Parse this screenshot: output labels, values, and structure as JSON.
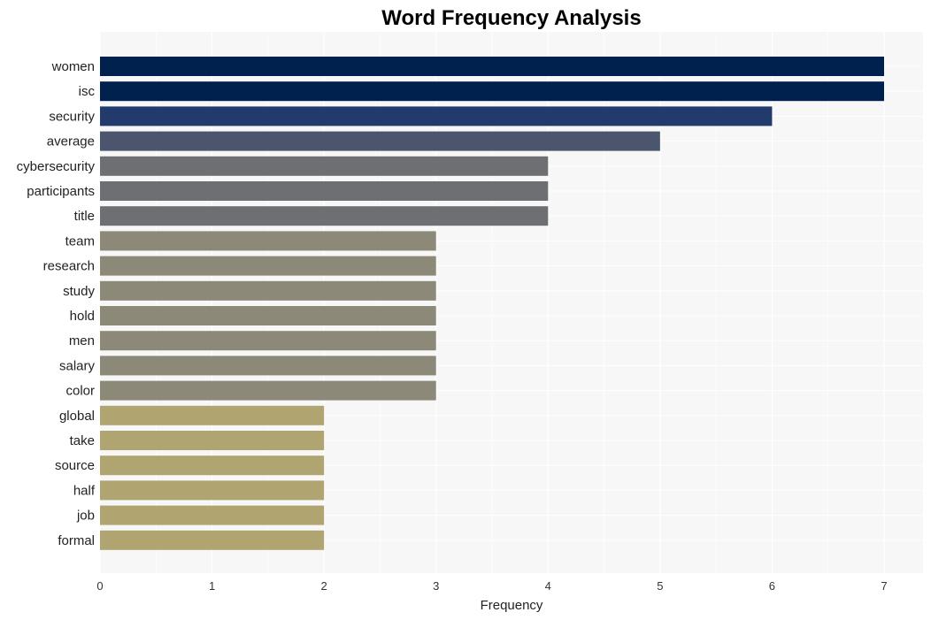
{
  "chart_data": {
    "type": "bar",
    "orientation": "horizontal",
    "title": "Word Frequency Analysis",
    "xlabel": "Frequency",
    "ylabel": "",
    "xlim": [
      0,
      7.35
    ],
    "xticks": [
      0,
      1,
      2,
      3,
      4,
      5,
      6,
      7
    ],
    "grid": true,
    "categories": [
      "women",
      "isc",
      "security",
      "average",
      "cybersecurity",
      "participants",
      "title",
      "team",
      "research",
      "study",
      "hold",
      "men",
      "salary",
      "color",
      "global",
      "take",
      "source",
      "half",
      "job",
      "formal"
    ],
    "values": [
      7,
      7,
      6,
      5,
      4,
      4,
      4,
      3,
      3,
      3,
      3,
      3,
      3,
      3,
      2,
      2,
      2,
      2,
      2,
      2
    ],
    "colors_by_value": {
      "7": "#00204e",
      "6": "#233a6d",
      "5": "#4b556e",
      "4": "#6e6f73",
      "3": "#8d8979",
      "2": "#b0a570"
    }
  }
}
